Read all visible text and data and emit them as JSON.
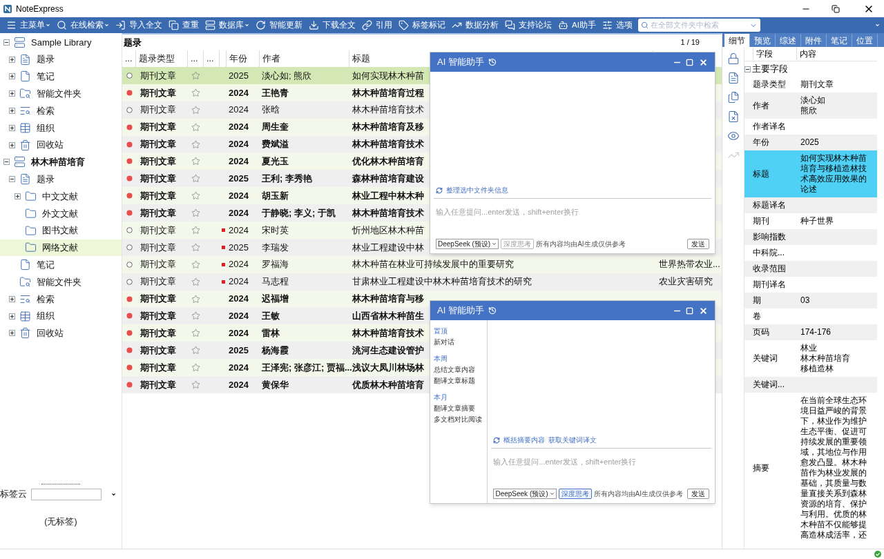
{
  "window": {
    "title": "NoteExpress"
  },
  "toolbar": {
    "items": [
      {
        "label": "主菜单",
        "dropdown": true
      },
      {
        "label": "在线检索",
        "dropdown": true
      },
      {
        "label": "导入全文",
        "dropdown": false
      },
      {
        "label": "查重",
        "dropdown": false
      },
      {
        "label": "数据库",
        "dropdown": true
      },
      {
        "label": "智能更新",
        "dropdown": false
      },
      {
        "label": "下载全文",
        "dropdown": false
      },
      {
        "label": "引用",
        "dropdown": false
      },
      {
        "label": "标签标记",
        "dropdown": false
      },
      {
        "label": "数据分析",
        "dropdown": false
      },
      {
        "label": "支持论坛",
        "dropdown": false
      },
      {
        "label": "AI助手",
        "dropdown": false
      },
      {
        "label": "选项",
        "dropdown": false
      }
    ],
    "search": {
      "placeholder": "在全部文件夹中检索"
    }
  },
  "tree": [
    {
      "label": "Sample Library",
      "kind": "library",
      "expanded": true,
      "active": false,
      "selected": false,
      "children": [
        {
          "label": "题录",
          "kind": "records",
          "expanded": false,
          "selected": false
        },
        {
          "label": "笔记",
          "kind": "notes",
          "expanded": false,
          "selected": false
        },
        {
          "label": "智能文件夹",
          "kind": "smart",
          "expanded": false,
          "selected": false
        },
        {
          "label": "检索",
          "kind": "search",
          "expanded": false,
          "selected": false
        },
        {
          "label": "组织",
          "kind": "org",
          "expanded": false,
          "selected": false
        },
        {
          "label": "回收站",
          "kind": "trash",
          "expanded": false,
          "selected": false
        }
      ]
    },
    {
      "label": "林木种苗培育",
      "kind": "library",
      "expanded": true,
      "active": true,
      "selected": false,
      "children": [
        {
          "label": "题录",
          "kind": "records",
          "expanded": true,
          "selected": false,
          "children": [
            {
              "label": "中文文献",
              "kind": "folder",
              "expanded": false,
              "selected": false
            },
            {
              "label": "外文文献",
              "kind": "folder",
              "selected": false
            },
            {
              "label": "图书文献",
              "kind": "folder",
              "selected": false
            },
            {
              "label": "网络文献",
              "kind": "folder",
              "selected": true
            }
          ]
        },
        {
          "label": "笔记",
          "kind": "notes",
          "selected": false
        },
        {
          "label": "智能文件夹",
          "kind": "smart",
          "selected": false
        },
        {
          "label": "检索",
          "kind": "search",
          "expanded": false,
          "selected": false
        },
        {
          "label": "组织",
          "kind": "org",
          "expanded": false,
          "selected": false
        },
        {
          "label": "回收站",
          "kind": "trash",
          "expanded": false,
          "selected": false
        }
      ]
    }
  ],
  "tag_cloud": {
    "label": "标签云",
    "empty_text": "(无标签)"
  },
  "list": {
    "title": "题录",
    "counter": "1 / 19",
    "columns": [
      "...",
      "题录类型",
      "...",
      "...",
      "年份",
      "作者",
      "标题"
    ],
    "rows": [
      {
        "read": true,
        "type": "期刊文章",
        "starred": false,
        "marked": false,
        "year": "2025",
        "author": "淡心如; 熊欣",
        "title": "如何实现林木种苗",
        "selected": true
      },
      {
        "read": false,
        "type": "期刊文章",
        "starred": false,
        "marked": false,
        "year": "2024",
        "author": "王艳青",
        "title": "林木种苗培育过程",
        "selected": false
      },
      {
        "read": true,
        "type": "期刊文章",
        "starred": false,
        "marked": false,
        "year": "2024",
        "author": "张晗",
        "title": "林木种苗培育技术",
        "selected": false
      },
      {
        "read": false,
        "type": "期刊文章",
        "starred": false,
        "marked": false,
        "year": "2024",
        "author": "周生奎",
        "title": "林木种苗培育及移",
        "selected": false
      },
      {
        "read": false,
        "type": "期刊文章",
        "starred": false,
        "marked": false,
        "year": "2024",
        "author": "费斌溢",
        "title": "林木种苗培育技术",
        "selected": false
      },
      {
        "read": false,
        "type": "期刊文章",
        "starred": false,
        "marked": false,
        "year": "2024",
        "author": "夏光玉",
        "title": "优化林木种苗培育",
        "selected": false
      },
      {
        "read": false,
        "type": "期刊文章",
        "starred": false,
        "marked": false,
        "year": "2025",
        "author": "王利; 李秀艳",
        "title": "森林种苗培育建设",
        "selected": false
      },
      {
        "read": false,
        "type": "期刊文章",
        "starred": false,
        "marked": false,
        "year": "2024",
        "author": "胡玉新",
        "title": "林业工程中林木种",
        "selected": false
      },
      {
        "read": false,
        "type": "期刊文章",
        "starred": false,
        "marked": false,
        "year": "2024",
        "author": "于静晓; 李义; 于凯",
        "title": "林木种苗培育技术",
        "selected": false
      },
      {
        "read": true,
        "type": "期刊文章",
        "starred": false,
        "marked": true,
        "year": "2024",
        "author": "宋时英",
        "title": "忻州地区林木种苗",
        "selected": false
      },
      {
        "read": true,
        "type": "期刊文章",
        "starred": false,
        "marked": true,
        "year": "2025",
        "author": "李瑞发",
        "title": "林业工程建设中林",
        "selected": false
      },
      {
        "read": true,
        "type": "期刊文章",
        "starred": false,
        "marked": true,
        "year": "2024",
        "author": "罗福海",
        "title": "林木种苗在林业可持续发展中的重要研究",
        "journal": "世界热带农业...",
        "selected": false
      },
      {
        "read": true,
        "type": "期刊文章",
        "starred": false,
        "marked": true,
        "year": "2024",
        "author": "马志程",
        "title": "甘肃林业工程建设中林木种苗培育技术的研究",
        "journal": "农业灾害研究",
        "selected": false
      },
      {
        "read": false,
        "type": "期刊文章",
        "starred": false,
        "marked": false,
        "year": "2024",
        "author": "迟福增",
        "title": "林木种苗培育与移",
        "selected": false
      },
      {
        "read": false,
        "type": "期刊文章",
        "starred": false,
        "marked": false,
        "year": "2024",
        "author": "王敏",
        "title": "山西省林木种苗生",
        "selected": false
      },
      {
        "read": false,
        "type": "期刊文章",
        "starred": false,
        "marked": false,
        "year": "2024",
        "author": "雷林",
        "title": "林木种苗培育技术",
        "selected": false
      },
      {
        "read": false,
        "type": "期刊文章",
        "starred": false,
        "marked": false,
        "year": "2025",
        "author": "杨海霞",
        "title": "洮河生态建设管护",
        "selected": false
      },
      {
        "read": false,
        "type": "期刊文章",
        "starred": false,
        "marked": false,
        "year": "2024",
        "author": "王泽宪; 张彦江; 贾福...",
        "title": "浅议大凤川林场林",
        "selected": false
      },
      {
        "read": false,
        "type": "期刊文章",
        "starred": false,
        "marked": false,
        "year": "2024",
        "author": "黄保华",
        "title": "优质林木种苗培育",
        "selected": false
      }
    ]
  },
  "ai_windows": [
    {
      "title": "AI 智能助手",
      "suggestions": [
        "整理选中文件夹信息"
      ],
      "input_placeholder": "输入任意提问...enter发送，shift+enter换行",
      "model": "DeepSeek (预设)",
      "deep_think": {
        "label": "深度思考",
        "on": false
      },
      "note": "所有内容均由AI生成仅供参考",
      "send": "发送"
    },
    {
      "title": "AI 智能助手",
      "history": [
        {
          "group": "置顶",
          "items": [
            "新对话"
          ]
        },
        {
          "group": "本周",
          "items": [
            "总结文章内容",
            "翻译文章标题"
          ]
        },
        {
          "group": "本月",
          "items": [
            "翻译文章摘要",
            "多文档对比阅读"
          ]
        }
      ],
      "suggestions": [
        "概括摘要内容",
        "获取关键词译文"
      ],
      "input_placeholder": "输入任意提问...enter发送，shift+enter换行",
      "model": "DeepSeek (预设)",
      "deep_think": {
        "label": "深度思考",
        "on": true
      },
      "note": "所有内容均由AI生成仅供参考",
      "send": "发送"
    }
  ],
  "details": {
    "tabs": [
      {
        "label": "细节",
        "selected": true
      },
      {
        "label": "预览",
        "selected": false
      },
      {
        "label": "综述",
        "selected": false
      },
      {
        "label": "附件",
        "selected": false
      },
      {
        "label": "笔记",
        "selected": false
      },
      {
        "label": "位置",
        "selected": false
      }
    ],
    "side_tools": [
      {
        "disabled": false
      },
      {
        "disabled": false
      },
      {
        "disabled": false
      },
      {
        "disabled": false
      },
      {
        "disabled": false
      },
      {
        "disabled": true
      }
    ],
    "columns": [
      "字段",
      "内容"
    ],
    "group": {
      "label": "主要字段",
      "expanded": true
    },
    "fields": [
      {
        "label": "题录类型",
        "value": "期刊文章",
        "selected": false
      },
      {
        "label": "作者",
        "values": [
          "淡心如",
          "熊欣"
        ],
        "selected": false
      },
      {
        "label": "作者译名",
        "selected": false
      },
      {
        "label": "年份",
        "value": "2025",
        "selected": false
      },
      {
        "label": "标题",
        "value": "如何实现林木种苗培育与移植造林技术高效应用效果的论述",
        "selected": true
      },
      {
        "label": "标题译名",
        "selected": false
      },
      {
        "label": "期刊",
        "value": "种子世界",
        "selected": false
      },
      {
        "label": "影响指数",
        "selected": false
      },
      {
        "label": "中科院...",
        "selected": false
      },
      {
        "label": "收录范围",
        "selected": false
      },
      {
        "label": "期刊译名",
        "selected": false
      },
      {
        "label": "期",
        "value": "03",
        "selected": false
      },
      {
        "label": "卷",
        "selected": false
      },
      {
        "label": "页码",
        "value": "174-176",
        "selected": false
      },
      {
        "label": "关键词",
        "values": [
          "林业",
          "林木种苗培育",
          "移植造林"
        ],
        "selected": false
      },
      {
        "label": "关键词...",
        "selected": false
      },
      {
        "label": "摘要",
        "value": "在当前全球生态环境日益严峻的背景下，林业作为维护生态平衡、促进可持续发展的重要领域，其地位与作用愈发凸显。林木种苗作为林业发展的基础，其质量与数量直接关系到森林资源的培育、保护与利用。优质的林木种苗不仅能够提高造林成活率，还",
        "selected": false
      }
    ]
  }
}
